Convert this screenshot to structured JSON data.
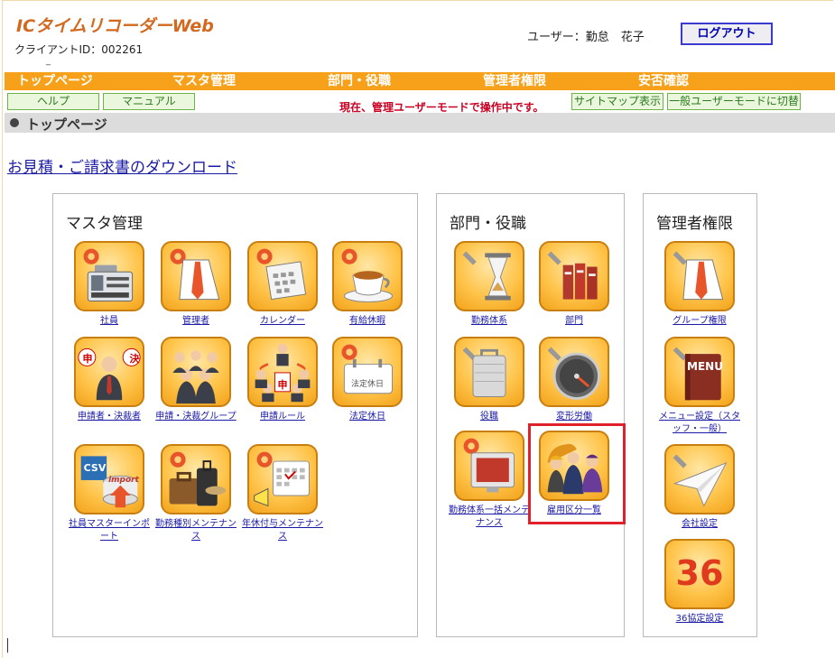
{
  "header": {
    "app_title": "ICタイムリコーダーWeb",
    "client_id": "クライアントID：002261",
    "dash": "_",
    "user": "ユーザー：勤怠　花子",
    "logout": "ログアウト"
  },
  "menu": [
    "トップページ",
    "マスタ管理",
    "部門・役職",
    "管理者権限",
    "安否確認"
  ],
  "subbar": {
    "help": "ヘルプ",
    "manual": "マニュアル",
    "mode_notice": "現在、管理ユーザーモードで操作中です。",
    "sitemap": "サイトマップ表示",
    "switch_mode": "一般ユーザーモードに切替"
  },
  "breadcrumb": "トップページ",
  "download_link": "お見積・ご請求書のダウンロード",
  "panels": {
    "master": {
      "title": "マスタ管理",
      "tiles": [
        "社員",
        "管理者",
        "カレンダー",
        "有給休暇",
        "申請者・決裁者",
        "申請・決裁グループ",
        "申請ルール",
        "法定休日",
        "社員マスターインポート",
        "勤務種別メンテナンス",
        "年休付与メンテナンス"
      ]
    },
    "dept": {
      "title": "部門・役職",
      "tiles": [
        "勤務体系",
        "部門",
        "役職",
        "変形労働",
        "勤務体系一括メンテナンス",
        "雇用区分一覧"
      ]
    },
    "admin": {
      "title": "管理者権限",
      "tiles": [
        "グループ権限",
        "メニュー設定（スタッフ・一般）",
        "会社設定",
        "36協定設定"
      ]
    }
  },
  "icon_text": {
    "csv": "CSV",
    "import": "import",
    "menu": "MENU",
    "holiday": "法定休日",
    "sho": "申",
    "ketsu": "決",
    "n36": "36"
  },
  "colors": {
    "orange_bar": "#f7a11a",
    "title_orange": "#d2691e",
    "mode_red": "#cc0022",
    "link_blue": "#1a1aa6",
    "highlight_red": "#e0202a"
  }
}
